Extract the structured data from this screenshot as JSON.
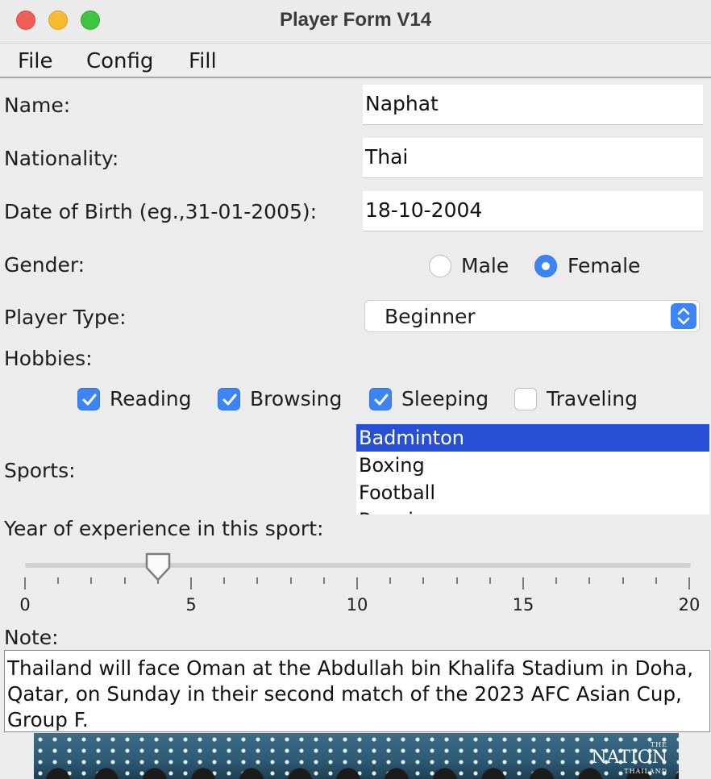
{
  "window": {
    "title": "Player Form V14"
  },
  "menu": {
    "items": [
      "File",
      "Config",
      "Fill"
    ]
  },
  "form": {
    "name_label": "Name:",
    "name_value": "Naphat",
    "nationality_label": "Nationality:",
    "nationality_value": "Thai",
    "dob_label": "Date of Birth (eg.,31-01-2005):",
    "dob_value": "18-10-2004",
    "gender_label": "Gender:",
    "gender_options": [
      {
        "label": "Male",
        "selected": false
      },
      {
        "label": "Female",
        "selected": true
      }
    ],
    "player_type_label": "Player Type:",
    "player_type_value": "Beginner",
    "hobbies_label": "Hobbies:",
    "hobbies": [
      {
        "label": "Reading",
        "checked": true
      },
      {
        "label": "Browsing",
        "checked": true
      },
      {
        "label": "Sleeping",
        "checked": true
      },
      {
        "label": "Traveling",
        "checked": false
      }
    ],
    "sports_label": "Sports:",
    "sports": [
      {
        "label": "Badminton",
        "selected": true
      },
      {
        "label": "Boxing",
        "selected": false
      },
      {
        "label": "Football",
        "selected": false
      },
      {
        "label": "Running",
        "selected": false
      }
    ],
    "experience_label": "Year of experience in this sport:",
    "experience": {
      "value": 4,
      "min": 0,
      "max": 20,
      "tick_labels": [
        "0",
        "5",
        "10",
        "15",
        "20"
      ]
    },
    "note_label": "Note:",
    "note_text": "Thailand will face Oman at the Abdullah bin Khalifa Stadium in Doha, Qatar, on Sunday in their second match of the 2023 AFC Asian Cup, Group F."
  },
  "image": {
    "logo_small": "THE",
    "logo_big": "NATION",
    "logo_sub": "THAILAND"
  },
  "colors": {
    "accent": "#3d85f7",
    "list_selection": "#2750d6"
  }
}
